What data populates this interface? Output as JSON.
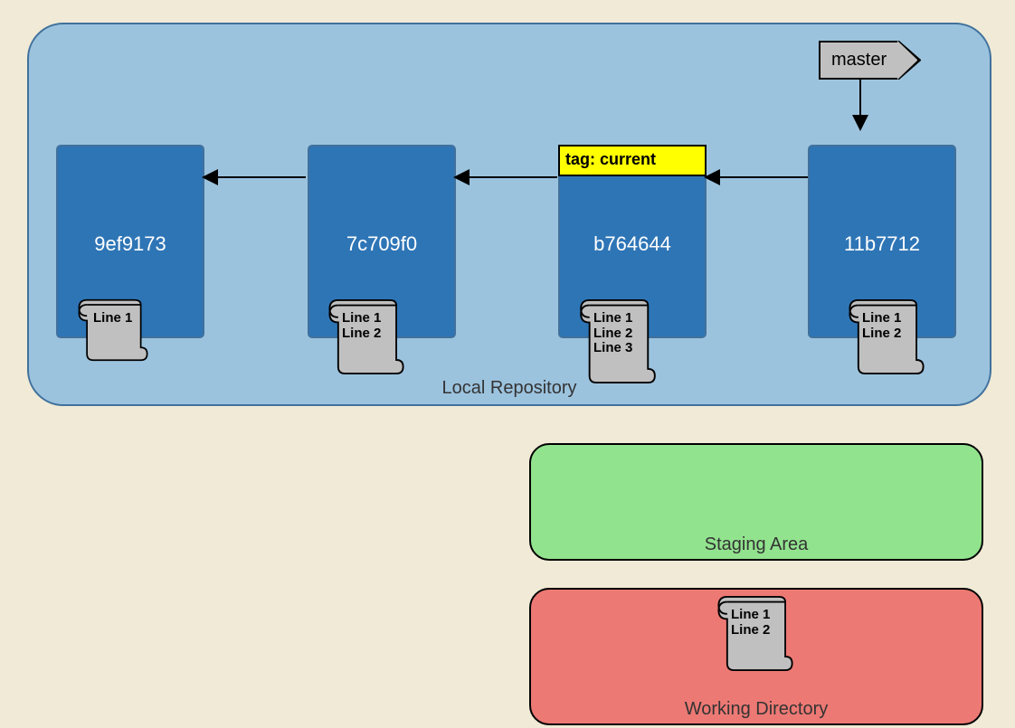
{
  "localRepo": {
    "label": "Local Repository"
  },
  "master": {
    "label": "master"
  },
  "tag": {
    "label": "tag: current"
  },
  "commits": [
    {
      "hash": "9ef9173",
      "lines": "Line 1"
    },
    {
      "hash": "7c709f0",
      "lines": "Line 1\nLine 2"
    },
    {
      "hash": "b764644",
      "lines": "Line 1\nLine 2\nLine 3"
    },
    {
      "hash": "11b7712",
      "lines": "Line 1\nLine 2"
    }
  ],
  "staging": {
    "label": "Staging Area"
  },
  "working": {
    "label": "Working Directory",
    "lines": "Line 1\nLine 2"
  }
}
